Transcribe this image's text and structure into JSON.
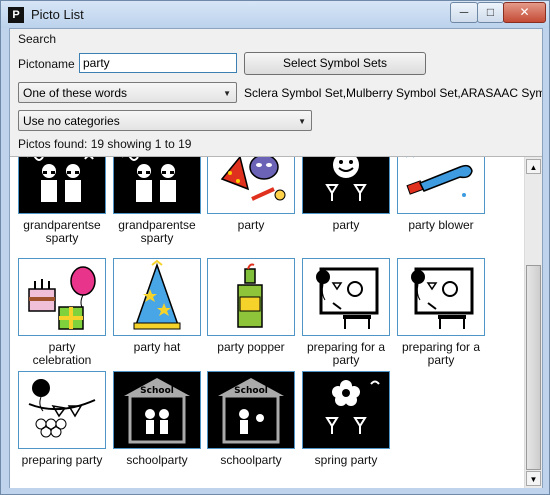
{
  "window": {
    "title": "Picto List",
    "min_glyph": "─",
    "max_glyph": "□",
    "close_glyph": "✕",
    "app_icon_glyph": "P"
  },
  "search": {
    "group_label": "Search",
    "pictoname_label": "Pictoname",
    "pictoname_value": "party",
    "select_symbol_sets_label": "Select Symbol Sets",
    "match_mode": "One of these words",
    "symbol_sets": "Sclera Symbol Set,Mulberry Symbol Set,ARASAAC Symb",
    "category": "Use no categories",
    "status": "Pictos found: 19 showing 1 to 19"
  },
  "results": {
    "items": [
      {
        "label": "grandparentse sparty",
        "icon": "grandparents-party-icon",
        "style": "dark"
      },
      {
        "label": "grandparentse sparty",
        "icon": "grandparents-party-icon",
        "style": "dark"
      },
      {
        "label": "party",
        "icon": "party-hat-mask-icon",
        "style": "color"
      },
      {
        "label": "party",
        "icon": "smiley-glasses-icon",
        "style": "dark"
      },
      {
        "label": "party blower",
        "icon": "party-blower-icon",
        "style": "color"
      },
      {
        "label": "party celebration",
        "icon": "cake-balloon-gift-icon",
        "style": "color"
      },
      {
        "label": "party hat",
        "icon": "party-hat-icon",
        "style": "color"
      },
      {
        "label": "party popper",
        "icon": "party-popper-bottle-icon",
        "style": "color"
      },
      {
        "label": "preparing for a party",
        "icon": "preparing-table-icon",
        "style": "line"
      },
      {
        "label": "preparing for a party",
        "icon": "preparing-table-icon",
        "style": "line"
      },
      {
        "label": "preparing party",
        "icon": "balloon-garland-icon",
        "style": "line"
      },
      {
        "label": "schoolparty",
        "icon": "school-party-icon",
        "style": "dark"
      },
      {
        "label": "schoolparty",
        "icon": "school-party-icon",
        "style": "dark"
      },
      {
        "label": "spring party",
        "icon": "flower-party-icon",
        "style": "dark"
      }
    ],
    "school_sign": "School"
  },
  "colors": {
    "accent_border": "#4f96c7",
    "close_red": "#c44b35",
    "titlebar": "#bfd4ec"
  }
}
